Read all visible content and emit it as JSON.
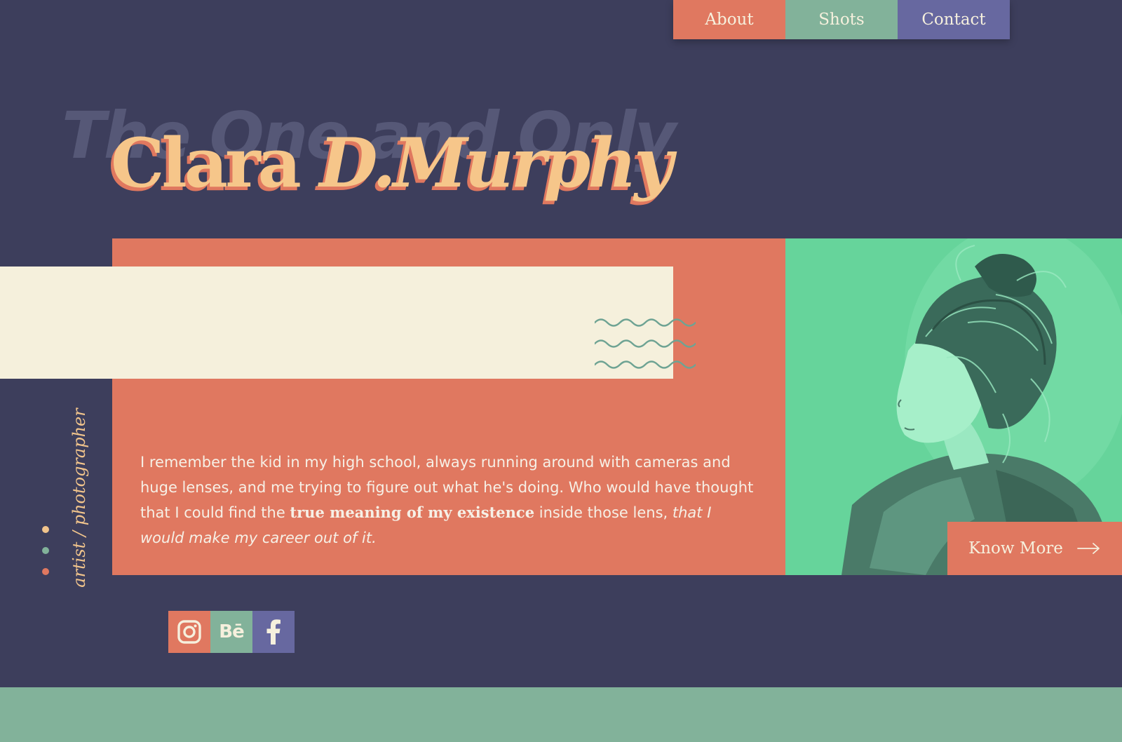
{
  "colors": {
    "background": "#3d3e5c",
    "coral": "#e07860",
    "sage": "#82b29a",
    "periwinkle": "#6768a0",
    "cream": "#f5f0dc",
    "gold": "#f6c68a",
    "photo_tint": "#66d49b"
  },
  "nav": {
    "items": [
      {
        "label": "About",
        "color": "#e07860"
      },
      {
        "label": "Shots",
        "color": "#82b29a"
      },
      {
        "label": "Contact",
        "color": "#6768a0"
      }
    ]
  },
  "hero": {
    "tagline": "The One and Only",
    "first_name": "Clara",
    "last_name": "D.Murphy"
  },
  "side": {
    "tagline": "artist / photographer",
    "dots": [
      "#f1c48c",
      "#82b29a",
      "#e07860"
    ]
  },
  "bio": {
    "part1": "I remember the kid in my high school, always running around with cameras and huge lenses, and me trying to figure out what he's doing. Who would have thought that I could find the ",
    "bold": "true meaning of my existence",
    "part2": " inside those lens, ",
    "italic": "that I would make my career out of it."
  },
  "cta": {
    "label": "Know More",
    "icon": "arrow-right-icon"
  },
  "social": [
    {
      "name": "instagram",
      "icon": "instagram-icon",
      "color": "#e07860"
    },
    {
      "name": "behance",
      "icon": "behance-icon",
      "label": "Bē",
      "color": "#82b29a"
    },
    {
      "name": "facebook",
      "icon": "facebook-icon",
      "color": "#6768a0"
    }
  ]
}
